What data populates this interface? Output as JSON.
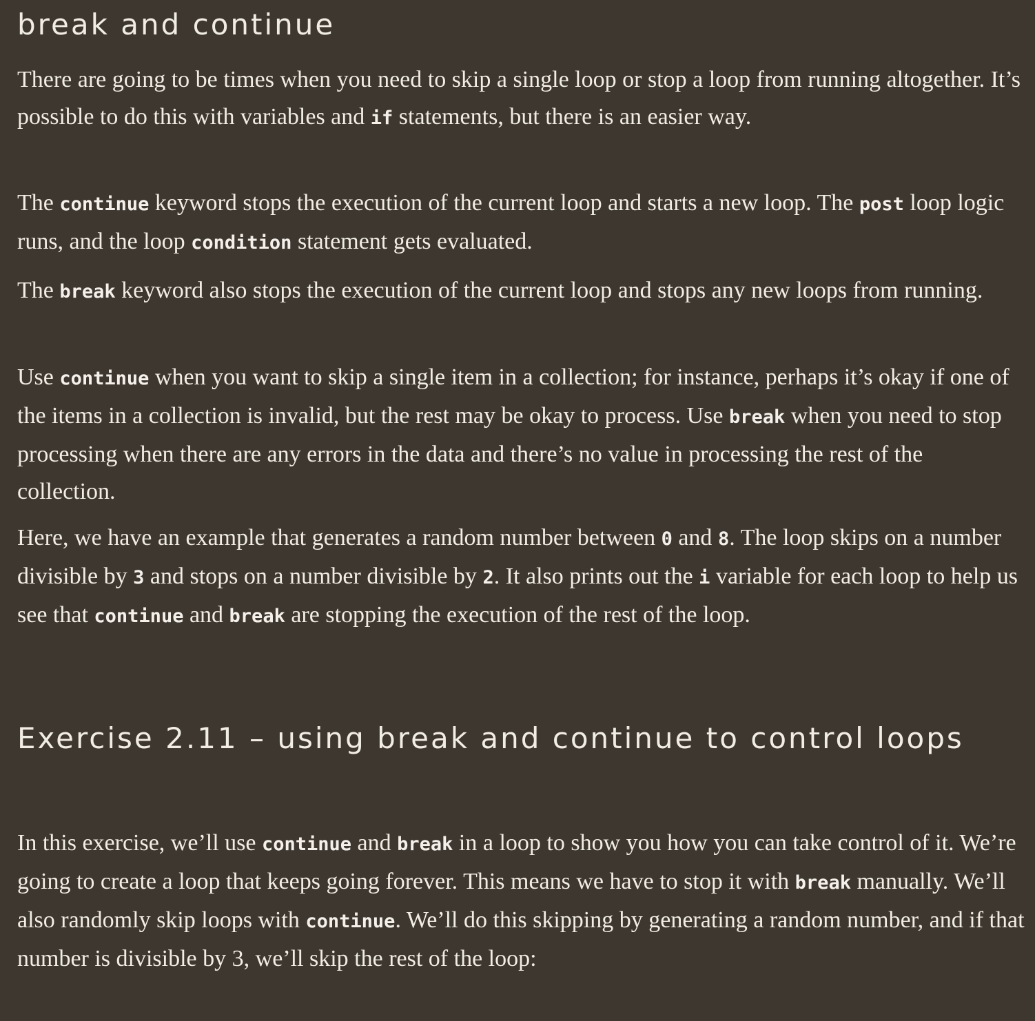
{
  "heading": "break and continue",
  "p1": {
    "a": "There are going to be times when you need to skip a single loop or stop a loop from running altogether. It’s possible to do this with variables and ",
    "code_if": "if",
    "b": " statements, but there is an easier way."
  },
  "p2": {
    "a": "The ",
    "code_continue": "continue",
    "b": " keyword stops the execution of the current loop and starts a new loop. The ",
    "code_post": "post",
    "c": " loop logic runs, and the loop ",
    "code_condition": "condition",
    "d": " statement gets evaluated."
  },
  "p3": {
    "a": "The ",
    "code_break": "break",
    "b": " keyword also stops the execution of the current loop and stops any new loops from running."
  },
  "p4": {
    "a": "Use ",
    "code_continue": "continue",
    "b": " when you want to skip a single item in a collection; for instance, perhaps it’s okay if one of the items in a collection is invalid, but the rest may be okay to process. Use ",
    "code_break": "break",
    "c": " when you need to stop processing when there are any errors in the data and there’s no value in processing the rest of the collection."
  },
  "p5": {
    "a": "Here, we have an example that generates a random number between ",
    "code_0": "0",
    "b": " and ",
    "code_8": "8",
    "c": ". The loop skips on a number divisible by ",
    "code_3": "3",
    "d": " and stops on a number divisible by ",
    "code_2": "2",
    "e": ". It also prints out the ",
    "code_i": "i",
    "f": " variable for each loop to help us see that ",
    "code_continue": "continue",
    "g": " and ",
    "code_break": "break",
    "h": " are stopping the execution of the rest of the loop."
  },
  "exercise_heading": "Exercise 2.11 – using break and continue to control loops",
  "p6": {
    "a": "In this exercise, we’ll use ",
    "code_continue": "continue",
    "b": " and ",
    "code_break": "break",
    "c": " in a loop to show you how you can take control of it. We’re going to create a loop that keeps going forever. This means we have to stop it with ",
    "code_break2": "break",
    "d": " manually. We’ll also randomly skip loops with ",
    "code_continue2": "continue",
    "e": ". We’ll do this skipping by generating a random number, and if that number is divisible by 3, we’ll skip the rest of the loop:"
  }
}
